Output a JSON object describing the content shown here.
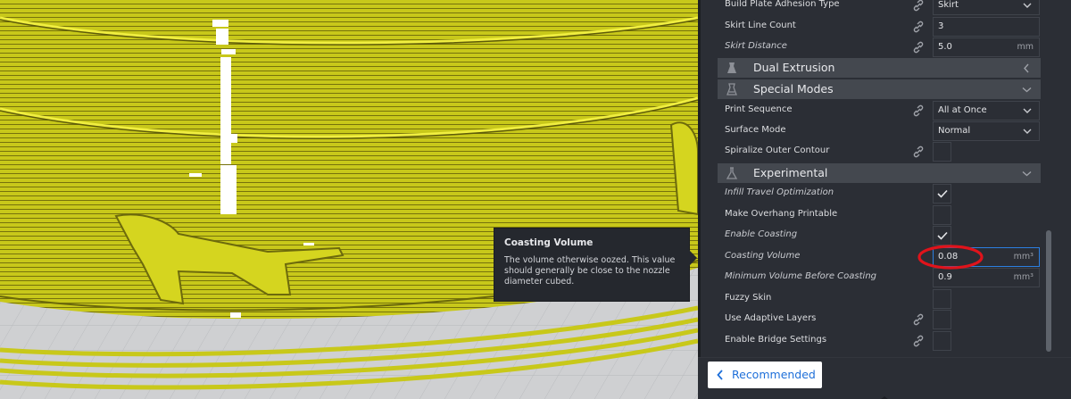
{
  "settings": {
    "rows": [
      {
        "label": "Build Plate Adhesion Type",
        "value": "Skirt",
        "type": "select",
        "linked": true,
        "italic": false
      },
      {
        "label": "Skirt Line Count",
        "value": "3",
        "type": "text",
        "linked": true,
        "italic": false
      },
      {
        "label": "Skirt Distance",
        "value": "5.0",
        "unit": "mm",
        "type": "text",
        "linked": true,
        "italic": true
      }
    ],
    "categories": {
      "dual_extrusion": "Dual Extrusion",
      "special_modes": "Special Modes",
      "experimental": "Experimental"
    },
    "special_rows": [
      {
        "label": "Print Sequence",
        "value": "All at Once",
        "type": "select",
        "linked": true,
        "italic": false
      },
      {
        "label": "Surface Mode",
        "value": "Normal",
        "type": "select",
        "linked": false,
        "italic": false
      },
      {
        "label": "Spiralize Outer Contour",
        "type": "checkbox",
        "checked": false,
        "linked": true,
        "italic": false
      }
    ],
    "experimental_rows": [
      {
        "label": "Infill Travel Optimization",
        "type": "checkbox",
        "checked": true,
        "linked": false,
        "italic": true
      },
      {
        "label": "Make Overhang Printable",
        "type": "checkbox",
        "checked": false,
        "linked": false,
        "italic": false
      },
      {
        "label": "Enable Coasting",
        "type": "checkbox",
        "checked": true,
        "linked": false,
        "italic": true
      },
      {
        "label": "Coasting Volume",
        "value": "0.08",
        "unit": "mm³",
        "type": "text",
        "linked": false,
        "italic": true,
        "active": true
      },
      {
        "label": "Minimum Volume Before Coasting",
        "value": "0.9",
        "unit": "mm³",
        "type": "text",
        "linked": false,
        "italic": true
      },
      {
        "label": "Fuzzy Skin",
        "type": "checkbox",
        "checked": false,
        "linked": false,
        "italic": false
      },
      {
        "label": "Use Adaptive Layers",
        "type": "checkbox",
        "checked": false,
        "linked": true,
        "italic": false
      },
      {
        "label": "Enable Bridge Settings",
        "type": "checkbox",
        "checked": false,
        "linked": true,
        "italic": false
      }
    ]
  },
  "tooltip": {
    "title": "Coasting Volume",
    "body": "The volume otherwise oozed. This value should generally be close to the nozzle diameter cubed."
  },
  "bottom": {
    "recommended_label": "Recommended"
  },
  "colors": {
    "print": "#c8c81a",
    "print_line": "#6d6a0c",
    "annotation": "#e0131b",
    "accent": "#1e6fd9"
  }
}
